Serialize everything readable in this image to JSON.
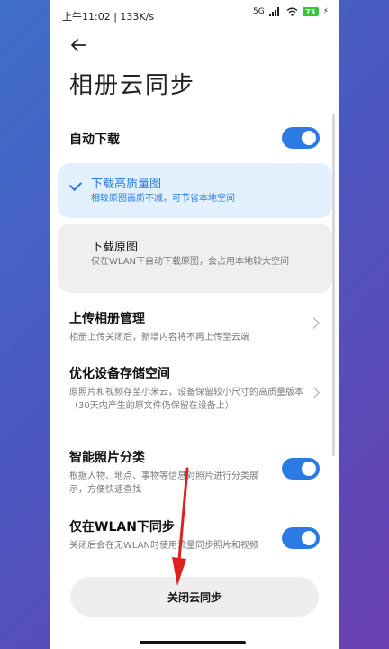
{
  "status_bar": {
    "time": "上午11:02 | 133K/s",
    "network": "5G",
    "battery": "73"
  },
  "header": {
    "title": "相册云同步"
  },
  "auto_download": {
    "label": "自动下载",
    "enabled": true
  },
  "download_options": [
    {
      "title": "下载高质量图",
      "desc": "相较原图画质不减，可节省本地空间",
      "selected": true
    },
    {
      "title": "下载原图",
      "desc": "仅在WLAN下自动下载原图，会占用本地较大空间",
      "selected": false
    }
  ],
  "upload_manage": {
    "title": "上传相册管理",
    "desc": "相册上传关闭后，新增内容将不再上传至云端"
  },
  "optimize_storage": {
    "title": "优化设备存储空间",
    "desc": "原照片和视频存至小米云，设备保留较小尺寸的高质量版本（30天内产生的原文件仍保留在设备上）"
  },
  "smart_classify": {
    "title": "智能照片分类",
    "desc": "根据人物、地点、事物等信息对照片进行分类展示，方便快速查找",
    "enabled": true
  },
  "wlan_only": {
    "title": "仅在WLAN下同步",
    "desc": "关闭后会在无WLAN时使用流量同步照片和视频",
    "enabled": true
  },
  "close_sync_button": "关闭云同步",
  "colors": {
    "accent": "#2c7be5",
    "annotation": "#e02020"
  }
}
